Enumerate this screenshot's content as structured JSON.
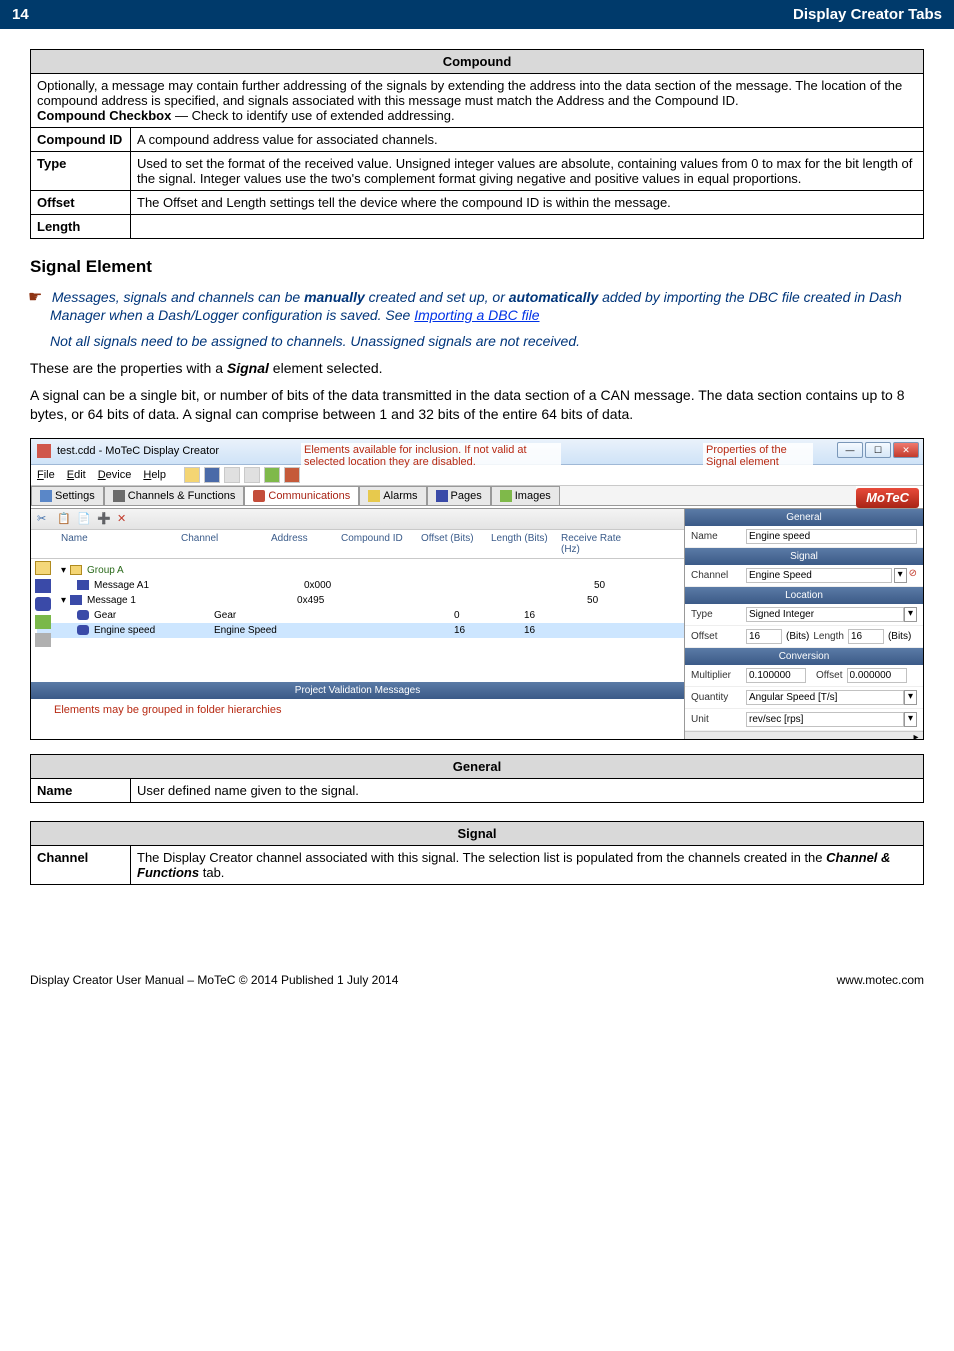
{
  "header": {
    "page_num": "14",
    "title": "Display Creator Tabs"
  },
  "compound_table": {
    "title": "Compound",
    "intro": "Optionally, a message may contain further addressing of the signals by extending the address into the data section of the message. The location of the compound address is specified, and signals associated with this message must match the Address and the Compound ID.",
    "checkbox_label": "Compound Checkbox",
    "checkbox_text": " — Check to identify use of extended addressing.",
    "rows": [
      {
        "label": "Compound ID",
        "text": "A compound address value for associated channels."
      },
      {
        "label": "Type",
        "text": "Used to set the format of the received value. Unsigned integer values are absolute, containing values from 0 to max for the bit length of the signal. Integer values use the two's complement format giving negative and positive values in equal proportions."
      },
      {
        "label": "Offset",
        "text": "The Offset and Length settings tell the device where the compound ID is within the message."
      },
      {
        "label": "Length",
        "text": ""
      }
    ]
  },
  "signal_element": {
    "heading": "Signal Element",
    "note1_pre": "Messages, signals and channels can be ",
    "note1_b1": "manually",
    "note1_mid": " created and set up, or ",
    "note1_b2": "automatically",
    "note1_post": " added by importing the DBC file created in Dash Manager when a Dash/Logger configuration is saved. See ",
    "note1_link": "Importing a DBC file",
    "note2": "Not all signals need to be assigned to channels. Unassigned signals are not received.",
    "para1_pre": "These are the properties with a ",
    "para1_bold": "Signal",
    "para1_post": " element selected.",
    "para2": "A signal can be a single bit, or number of bits of the data transmitted in the data section of a CAN message. The data section contains up to 8 bytes, or 64 bits of data. A signal can comprise between 1 and 32 bits of the entire 64 bits of data."
  },
  "screenshot": {
    "window_title": "test.cdd - MoTeC Display Creator",
    "menu": {
      "file": "File",
      "edit": "Edit",
      "device": "Device",
      "help": "Help"
    },
    "tabs": {
      "settings": "Settings",
      "channels": "Channels & Functions",
      "comms": "Communications",
      "alarms": "Alarms",
      "pages": "Pages",
      "images": "Images"
    },
    "logo": "MoTeC",
    "callout_elements": "Elements available for inclusion. If not valid at selected location they are disabled.",
    "callout_props": "Properties of the Signal element",
    "callout_grouped": "Elements may be grouped in folder hierarchies",
    "grid_headers": {
      "name": "Name",
      "channel": "Channel",
      "address": "Address",
      "cid": "Compound ID",
      "offset": "Offset (Bits)",
      "length": "Length (Bits)",
      "rate": "Receive Rate (Hz)"
    },
    "tree": {
      "group": "Group A",
      "msgA1": {
        "name": "Message A1",
        "addr": "0x000",
        "rate": "50"
      },
      "msg1": {
        "name": "Message 1",
        "addr": "0x495",
        "rate": "50"
      },
      "gear": {
        "name": "Gear",
        "channel": "Gear",
        "offset": "0",
        "length": "16"
      },
      "engspd": {
        "name": "Engine speed",
        "channel": "Engine Speed",
        "offset": "16",
        "length": "16"
      }
    },
    "footer_label": "Project Validation Messages",
    "props": {
      "general": "General",
      "name_label": "Name",
      "name_val": "Engine speed",
      "signal": "Signal",
      "channel_label": "Channel",
      "channel_val": "Engine Speed",
      "location": "Location",
      "type_label": "Type",
      "type_val": "Signed Integer",
      "offset_label": "Offset",
      "offset_val": "16",
      "bits": "(Bits)",
      "length_label": "Length",
      "length_val": "16",
      "conversion": "Conversion",
      "mult_label": "Multiplier",
      "mult_val": "0.100000",
      "offs2_label": "Offset",
      "offs2_val": "0.000000",
      "qty_label": "Quantity",
      "qty_val": "Angular Speed [T/s]",
      "unit_label": "Unit",
      "unit_val": "rev/sec [rps]"
    }
  },
  "general_table": {
    "title": "General",
    "label": "Name",
    "text": "User defined name given to the signal."
  },
  "signal_table": {
    "title": "Signal",
    "label": "Channel",
    "text_pre": "The Display Creator channel associated with this signal. The selection list is populated from the channels created in the ",
    "text_bold": "Channel & Functions",
    "text_post": " tab."
  },
  "footer": {
    "left": "Display Creator User Manual – MoTeC © 2014 Published 1 July 2014",
    "right": "www.motec.com"
  }
}
